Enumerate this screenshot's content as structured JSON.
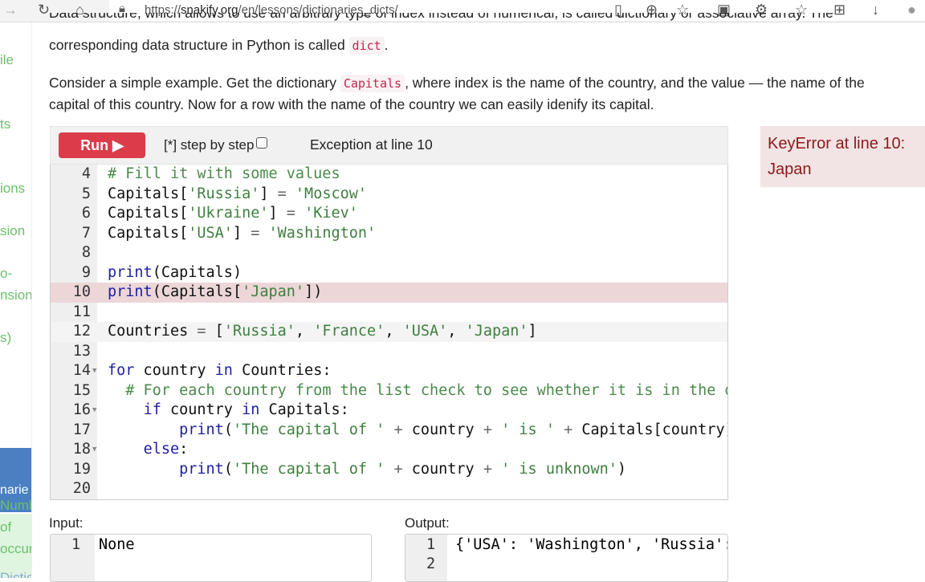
{
  "browser": {
    "url_prefix": "https://",
    "url_domain": "snakify.org",
    "url_path": "/en/lessons/dictionaries_dicts/",
    "icons": [
      "arrow-right-icon",
      "reload-icon",
      "home-icon",
      "lock-icon",
      "reader-icon",
      "zoom-icon",
      "favorite-add-icon",
      "collections-icon",
      "extensions-icon",
      "favorites-icon",
      "add-tab-icon",
      "downloads-icon",
      "profile-icon"
    ]
  },
  "sidebar": {
    "items": [
      "ile",
      "ts",
      "ions",
      "sion",
      "o-",
      "nsion",
      "s)"
    ],
    "active": "narie",
    "sub": [
      "Numb",
      "of",
      "occur"
    ],
    "next": "Dictio"
  },
  "content": {
    "p1_line1": "Data structure, which allows to use an arbitrary type of index instead of numerical, is called dictionary or associative array. The",
    "p1_line2_a": "corresponding data structure in Python is called ",
    "p1_code": "dict",
    "p1_line2_b": ".",
    "p2_line1_a": "Consider a simple example. Get the dictionary ",
    "p2_code": "Capitals",
    "p2_line1_b": ", where index is the name of the country, and the value — the name of the",
    "p2_line2": "capital of this country. Now for a row with the name of the country we can easily idenify its capital."
  },
  "toolbar": {
    "run_label": "Run ▶",
    "step_label": "[*] step by step",
    "exception_text": "Exception at line 10"
  },
  "error": {
    "text": "KeyError at line 10: Japan"
  },
  "editor": {
    "lines": [
      {
        "n": "4",
        "t": [
          [
            "# Fill it with some values",
            "cm"
          ]
        ]
      },
      {
        "n": "5",
        "t": [
          [
            "Capitals[",
            ""
          ],
          [
            "'Russia'",
            "str"
          ],
          [
            "] ",
            ""
          ],
          [
            "=",
            "op"
          ],
          [
            " ",
            ""
          ],
          [
            "'Moscow'",
            "str"
          ]
        ]
      },
      {
        "n": "6",
        "t": [
          [
            "Capitals[",
            ""
          ],
          [
            "'Ukraine'",
            "str"
          ],
          [
            "] ",
            ""
          ],
          [
            "=",
            "op"
          ],
          [
            " ",
            ""
          ],
          [
            "'Kiev'",
            "str"
          ]
        ]
      },
      {
        "n": "7",
        "t": [
          [
            "Capitals[",
            ""
          ],
          [
            "'USA'",
            "str"
          ],
          [
            "] ",
            ""
          ],
          [
            "=",
            "op"
          ],
          [
            " ",
            ""
          ],
          [
            "'Washington'",
            "str"
          ]
        ]
      },
      {
        "n": "8",
        "t": []
      },
      {
        "n": "9",
        "t": [
          [
            "print",
            "kw"
          ],
          [
            "(Capitals)",
            ""
          ]
        ]
      },
      {
        "n": "10",
        "t": [
          [
            "print",
            "kw"
          ],
          [
            "(Capitals[",
            ""
          ],
          [
            "'Japan'",
            "str"
          ],
          [
            "])",
            ""
          ]
        ],
        "state": "error"
      },
      {
        "n": "11",
        "t": []
      },
      {
        "n": "12",
        "t": [
          [
            "Countries ",
            ""
          ],
          [
            "=",
            "op"
          ],
          [
            " [",
            ""
          ],
          [
            "'Russia'",
            "str"
          ],
          [
            ", ",
            ""
          ],
          [
            "'France'",
            "str"
          ],
          [
            ", ",
            ""
          ],
          [
            "'USA'",
            "str"
          ],
          [
            ", ",
            ""
          ],
          [
            "'Japan'",
            "str"
          ],
          [
            "]",
            ""
          ]
        ],
        "state": "active"
      },
      {
        "n": "13",
        "t": []
      },
      {
        "n": "14",
        "fold": true,
        "t": [
          [
            "for",
            "kw"
          ],
          [
            " country ",
            ""
          ],
          [
            "in",
            "kw"
          ],
          [
            " Countries:",
            ""
          ]
        ]
      },
      {
        "n": "15",
        "t": [
          [
            "  ",
            ""
          ],
          [
            "# For each country from the list check to see whether it is in the dictionary",
            "cm"
          ]
        ]
      },
      {
        "n": "16",
        "fold": true,
        "t": [
          [
            "    ",
            ""
          ],
          [
            "if",
            "kw"
          ],
          [
            " country ",
            ""
          ],
          [
            "in",
            "kw"
          ],
          [
            " Capitals:",
            ""
          ]
        ]
      },
      {
        "n": "17",
        "t": [
          [
            "        ",
            ""
          ],
          [
            "print",
            "kw"
          ],
          [
            "(",
            ""
          ],
          [
            "'The capital of '",
            "str"
          ],
          [
            " ",
            ""
          ],
          [
            "+",
            "op"
          ],
          [
            " country ",
            ""
          ],
          [
            "+",
            "op"
          ],
          [
            " ",
            ""
          ],
          [
            "' is '",
            "str"
          ],
          [
            " ",
            ""
          ],
          [
            "+",
            "op"
          ],
          [
            " Capitals[country])",
            ""
          ]
        ]
      },
      {
        "n": "18",
        "fold": true,
        "t": [
          [
            "    ",
            ""
          ],
          [
            "else",
            "kw"
          ],
          [
            ":",
            ""
          ]
        ]
      },
      {
        "n": "19",
        "t": [
          [
            "        ",
            ""
          ],
          [
            "print",
            "kw"
          ],
          [
            "(",
            ""
          ],
          [
            "'The capital of '",
            "str"
          ],
          [
            " ",
            ""
          ],
          [
            "+",
            "op"
          ],
          [
            " country ",
            ""
          ],
          [
            "+",
            "op"
          ],
          [
            " ",
            ""
          ],
          [
            "' is unknown'",
            "str"
          ],
          [
            ")",
            ""
          ]
        ]
      },
      {
        "n": "20",
        "t": []
      }
    ]
  },
  "input": {
    "label": "Input:",
    "lines": [
      {
        "n": "1",
        "text": "None"
      }
    ]
  },
  "output": {
    "label": "Output:",
    "lines": [
      {
        "n": "1",
        "text": "{'USA': 'Washington', 'Russia': 'Moscow', 'Ukraine': 'Kiev'}"
      },
      {
        "n": "2",
        "text": ""
      }
    ]
  },
  "colors": {
    "run": "#dc3c4a",
    "error_bg": "#f2e3e4",
    "error_text": "#8b1a1a",
    "keyword": "#1f1f9e",
    "string": "#3f7f3f",
    "sidebar_active": "#4a7fc1"
  }
}
